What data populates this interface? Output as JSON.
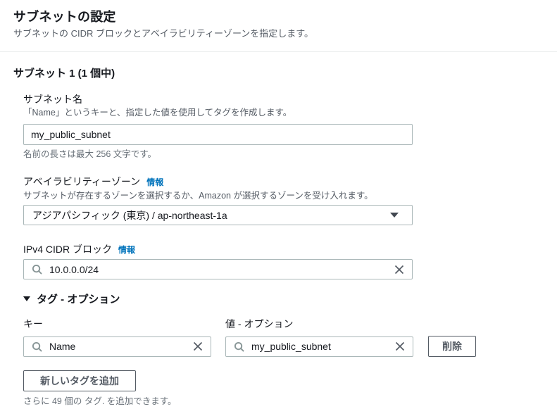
{
  "header": {
    "title": "サブネットの設定",
    "description": "サブネットの CIDR ブロックとアベイラビリティーゾーンを指定します。"
  },
  "subnet": {
    "heading": "サブネット 1 (1 個中)",
    "name": {
      "label": "サブネット名",
      "description": "「Name」というキーと、指定した値を使用してタグを作成します。",
      "value": "my_public_subnet",
      "constraint": "名前の長さは最大 256 文字です。"
    },
    "availability_zone": {
      "label": "アベイラビリティーゾーン",
      "info_link": "情報",
      "description": "サブネットが存在するゾーンを選択するか、Amazon が選択するゾーンを受け入れます。",
      "selected": "アジアパシフィック (東京) / ap-northeast-1a"
    },
    "cidr": {
      "label": "IPv4 CIDR ブロック",
      "info_link": "情報",
      "value": "10.0.0.0/24"
    },
    "tags": {
      "section_label": "タグ - オプション",
      "key_label": "キー",
      "value_label": "値 - オプション",
      "rows": [
        {
          "key": "Name",
          "value": "my_public_subnet"
        }
      ],
      "delete_button": "削除",
      "add_button": "新しいタグを追加",
      "remaining_hint": "さらに 49 個の タグ. を追加できます。"
    }
  },
  "colors": {
    "link_blue": "#0073bb",
    "text_dark": "#16191f",
    "text_gray": "#545b64",
    "input_border": "#aab7b8",
    "button_border": "#545b64",
    "divider": "#eaeded"
  }
}
